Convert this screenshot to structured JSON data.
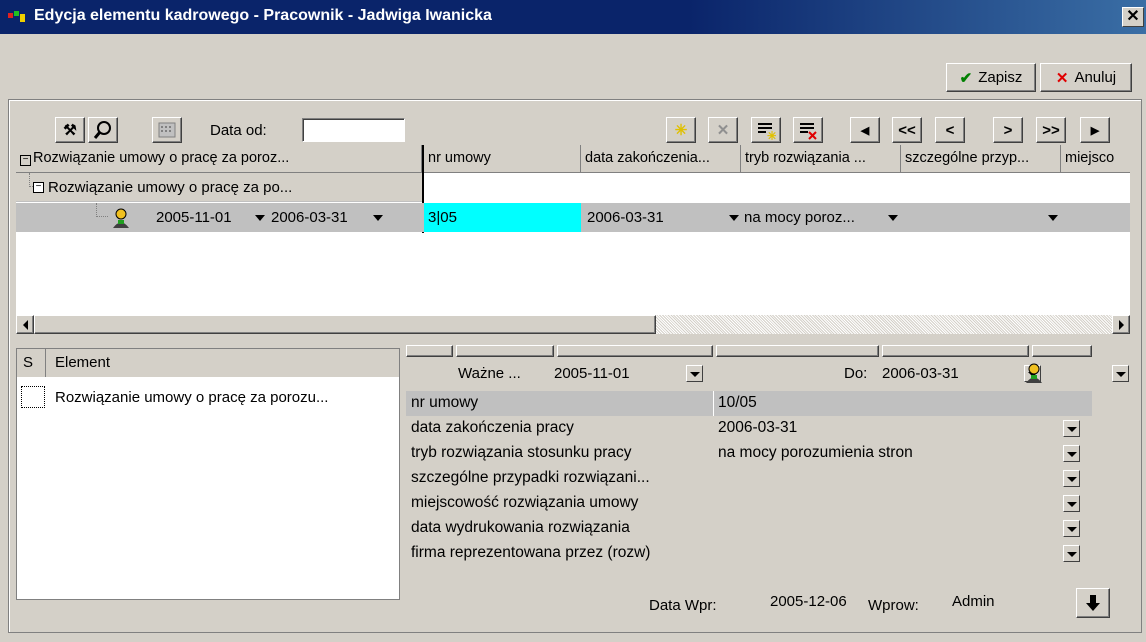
{
  "window": {
    "title": "Edycja elementu kadrowego - Pracownik - Jadwiga Iwanicka",
    "close": "✕"
  },
  "actions": {
    "save": "Zapisz",
    "cancel": "Anuluj"
  },
  "toolbar": {
    "date_from_label": "Data od:",
    "date_from_value": "",
    "nav": [
      "◀",
      "<<",
      "<",
      ">",
      ">>",
      "▶"
    ]
  },
  "tree": {
    "header": "Rozwiązanie umowy o pracę za poroz...",
    "child": "Rozwiązanie umowy o pracę za po...",
    "leaf_from": "2005-11-01",
    "leaf_to": "2006-03-31"
  },
  "grid": {
    "columns": [
      "nr umowy",
      "data zakończenia...",
      "tryb rozwiązania ...",
      "szczególne przyp...",
      "miejsco"
    ],
    "row": {
      "nr": "3|05",
      "data": "2006-03-31",
      "tryb": "na mocy poroz..."
    }
  },
  "elements": {
    "col_s": "S",
    "col_element": "Element",
    "items": [
      "Rozwiązanie umowy o pracę za porozu..."
    ]
  },
  "details": {
    "valid_label": "Ważne ...",
    "valid_from": "2005-11-01",
    "to_label": "Do:",
    "valid_to": "2006-03-31",
    "rows": [
      {
        "k": "nr umowy",
        "v": "10/05"
      },
      {
        "k": "data zakończenia pracy",
        "v": "2006-03-31"
      },
      {
        "k": "tryb rozwiązania stosunku pracy",
        "v": "na mocy porozumienia stron"
      },
      {
        "k": "szczególne przypadki rozwiązani...",
        "v": ""
      },
      {
        "k": "miejscowość rozwiązania umowy",
        "v": ""
      },
      {
        "k": "data wydrukowania rozwiązania",
        "v": ""
      },
      {
        "k": "firma reprezentowana przez (rozw)",
        "v": ""
      }
    ]
  },
  "footer": {
    "entry_date_label": "Data Wpr:",
    "entry_date": "2005-12-06",
    "entered_by_label": "Wprow:",
    "entered_by": "Admin"
  },
  "colors": {
    "titlebar": "#0a246a",
    "selected_cell": "#00ffff",
    "selected_row": "#c0c0c0",
    "face": "#d4d0c8"
  }
}
